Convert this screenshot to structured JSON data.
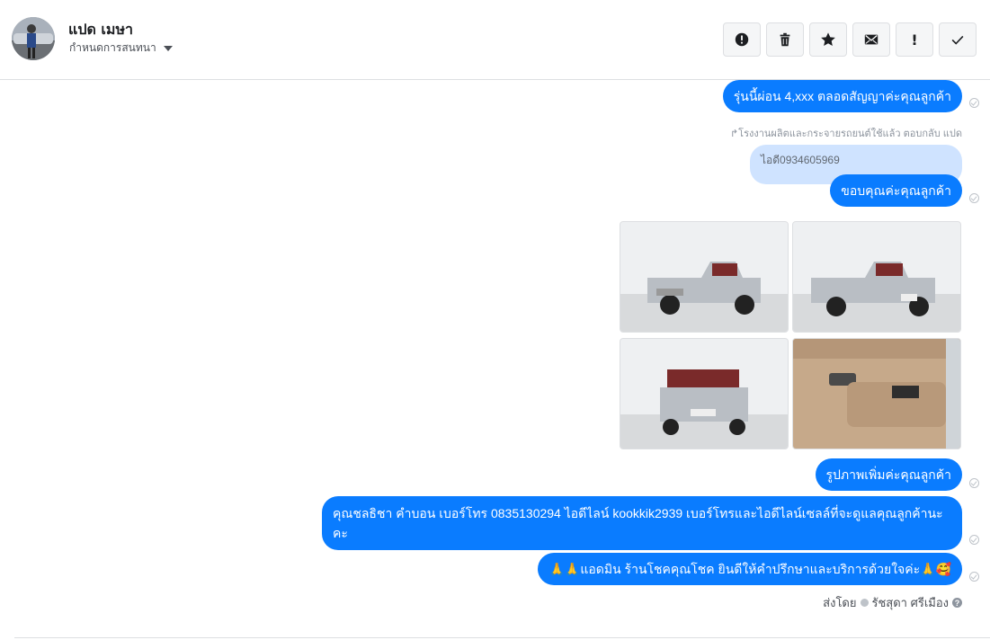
{
  "header": {
    "name": "แปด เมษา",
    "subtitle": "กำหนดการสนทนา",
    "toolbar": [
      {
        "icon": "alert-circle-icon",
        "name": "spam-button"
      },
      {
        "icon": "trash-icon",
        "name": "delete-button"
      },
      {
        "icon": "star-icon",
        "name": "star-button"
      },
      {
        "icon": "envelope-icon",
        "name": "mark-unread-button"
      },
      {
        "icon": "exclamation-icon",
        "name": "follow-up-button",
        "glyph": "!"
      },
      {
        "icon": "checkmark-icon",
        "name": "done-button"
      }
    ]
  },
  "messages": {
    "m1": "รุ่นนี้ผ่อน 4,xxx ตลอดสัญญาค่ะคุณลูกค้า",
    "reply_note": "โรงงานผลิตและกระจายรถยนต์ใช้แล้ว ตอบกลับ แปด",
    "reply_quote": "ไอดี0934605969",
    "m2": "ขอบคุณค่ะคุณลูกค้า",
    "m3": "รูปภาพเพิ่มค่ะคุณลูกค้า",
    "m4": "คุณชลธิชา คำบอน เบอร์โทร 0835130294  ไอดีไลน์ kookkik2939  เบอร์โทรและไอดีไลน์เซลล์ที่จะดูแลคุณลูกค้านะคะ",
    "m5": "🙏🙏แอดมิน ร้านโชคคุณโชค ยินดีให้คำปรึกษาและบริการด้วยใจค่ะ🙏🥰"
  },
  "footer": {
    "sent_by_label": "ส่งโดย",
    "sender_name": "รัชสุดา ศรีเมือง"
  },
  "photos": [
    {
      "name": "truck-photo-front-left"
    },
    {
      "name": "truck-photo-front-left-2"
    },
    {
      "name": "truck-photo-front"
    },
    {
      "name": "door-interior-photo"
    }
  ],
  "colors": {
    "bubble": "#0a7cff",
    "reply_bubble": "#cfe3ff"
  }
}
